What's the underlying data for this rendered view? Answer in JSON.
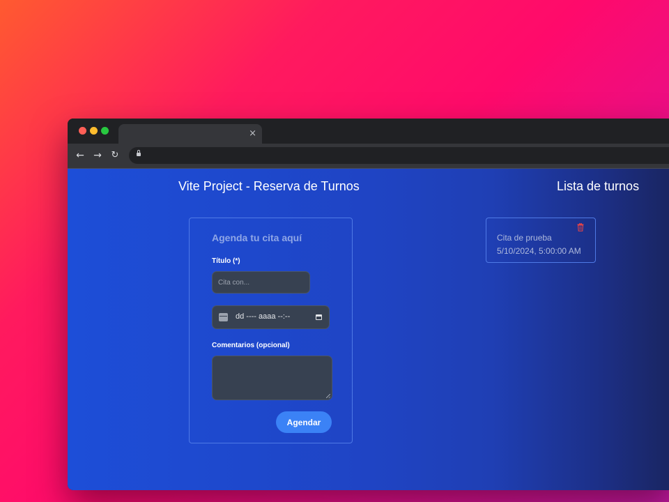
{
  "browser": {
    "tab_close_glyph": "×",
    "nav": {
      "back": "←",
      "forward": "→",
      "reload": "↻"
    }
  },
  "page": {
    "title": "Vite Project - Reserva de Turnos",
    "list_title": "Lista de turnos"
  },
  "form": {
    "heading": "Agenda tu cita aquí",
    "title_label": "Título (*)",
    "title_placeholder": "Cita con...",
    "title_value": "",
    "datetime_placeholder": "dd ---- aaaa --:--",
    "comments_label": "Comentarios (opcional)",
    "comments_value": "",
    "submit_label": "Agendar"
  },
  "appointments": [
    {
      "title": "Cita de prueba",
      "datetime": "5/10/2024, 5:00:00 AM"
    }
  ],
  "colors": {
    "accent": "#3b82f6",
    "delete": "#ef4444",
    "card_border": "#4f7ae6"
  },
  "icons": [
    "lock-icon",
    "calendar-icon",
    "calendar-picker-icon",
    "trash-icon",
    "close-icon"
  ]
}
